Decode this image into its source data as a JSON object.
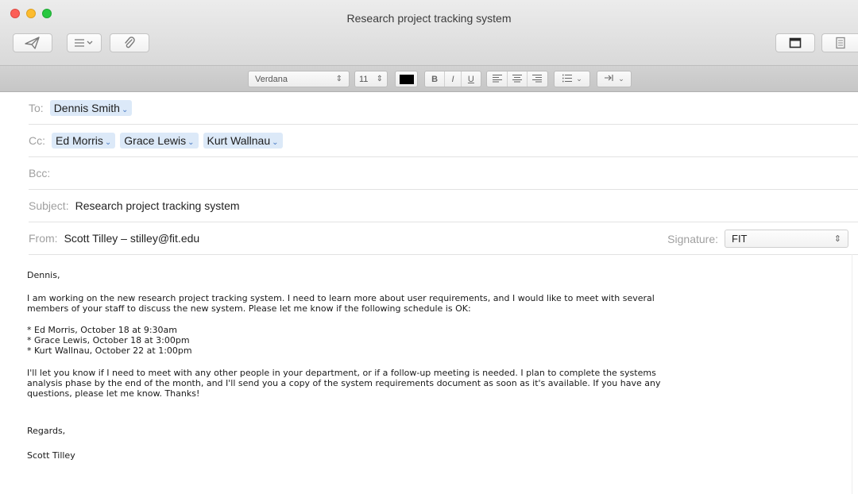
{
  "window": {
    "title": "Research project tracking system"
  },
  "format": {
    "font": "Verdana",
    "size": "11",
    "bold": "B",
    "italic": "I",
    "underline": "U"
  },
  "header": {
    "to_label": "To:",
    "to": [
      "Dennis Smith"
    ],
    "cc_label": "Cc:",
    "cc": [
      "Ed Morris",
      "Grace Lewis",
      "Kurt Wallnau"
    ],
    "bcc_label": "Bcc:",
    "subject_label": "Subject:",
    "subject": "Research project tracking system",
    "from_label": "From:",
    "from": "Scott Tilley – stilley@fit.edu",
    "signature_label": "Signature:",
    "signature": "FIT"
  },
  "body": {
    "greeting": "Dennis,",
    "para1_line1": "I am working on the new research project tracking system. I need to learn more about user requirements, and I would like to meet with several",
    "para1_line2": "members of your staff to discuss the new system. Please let me know if the following schedule is OK:",
    "bullets": [
      "* Ed Morris, October 18 at 9:30am",
      "* Grace Lewis, October 18 at 3:00pm",
      "* Kurt Wallnau, October 22 at 1:00pm"
    ],
    "para2_line1": "I'll let you know if I need to meet with any other people in your department, or if a follow-up meeting is needed. I plan to complete the systems",
    "para2_line2": "analysis phase by the end of the month, and I'll send you a copy of the system requirements document as soon as it's available. If you have any",
    "para2_line3": "questions, please let me know. Thanks!",
    "closing": "Regards,",
    "signature_name": "Scott Tilley"
  }
}
